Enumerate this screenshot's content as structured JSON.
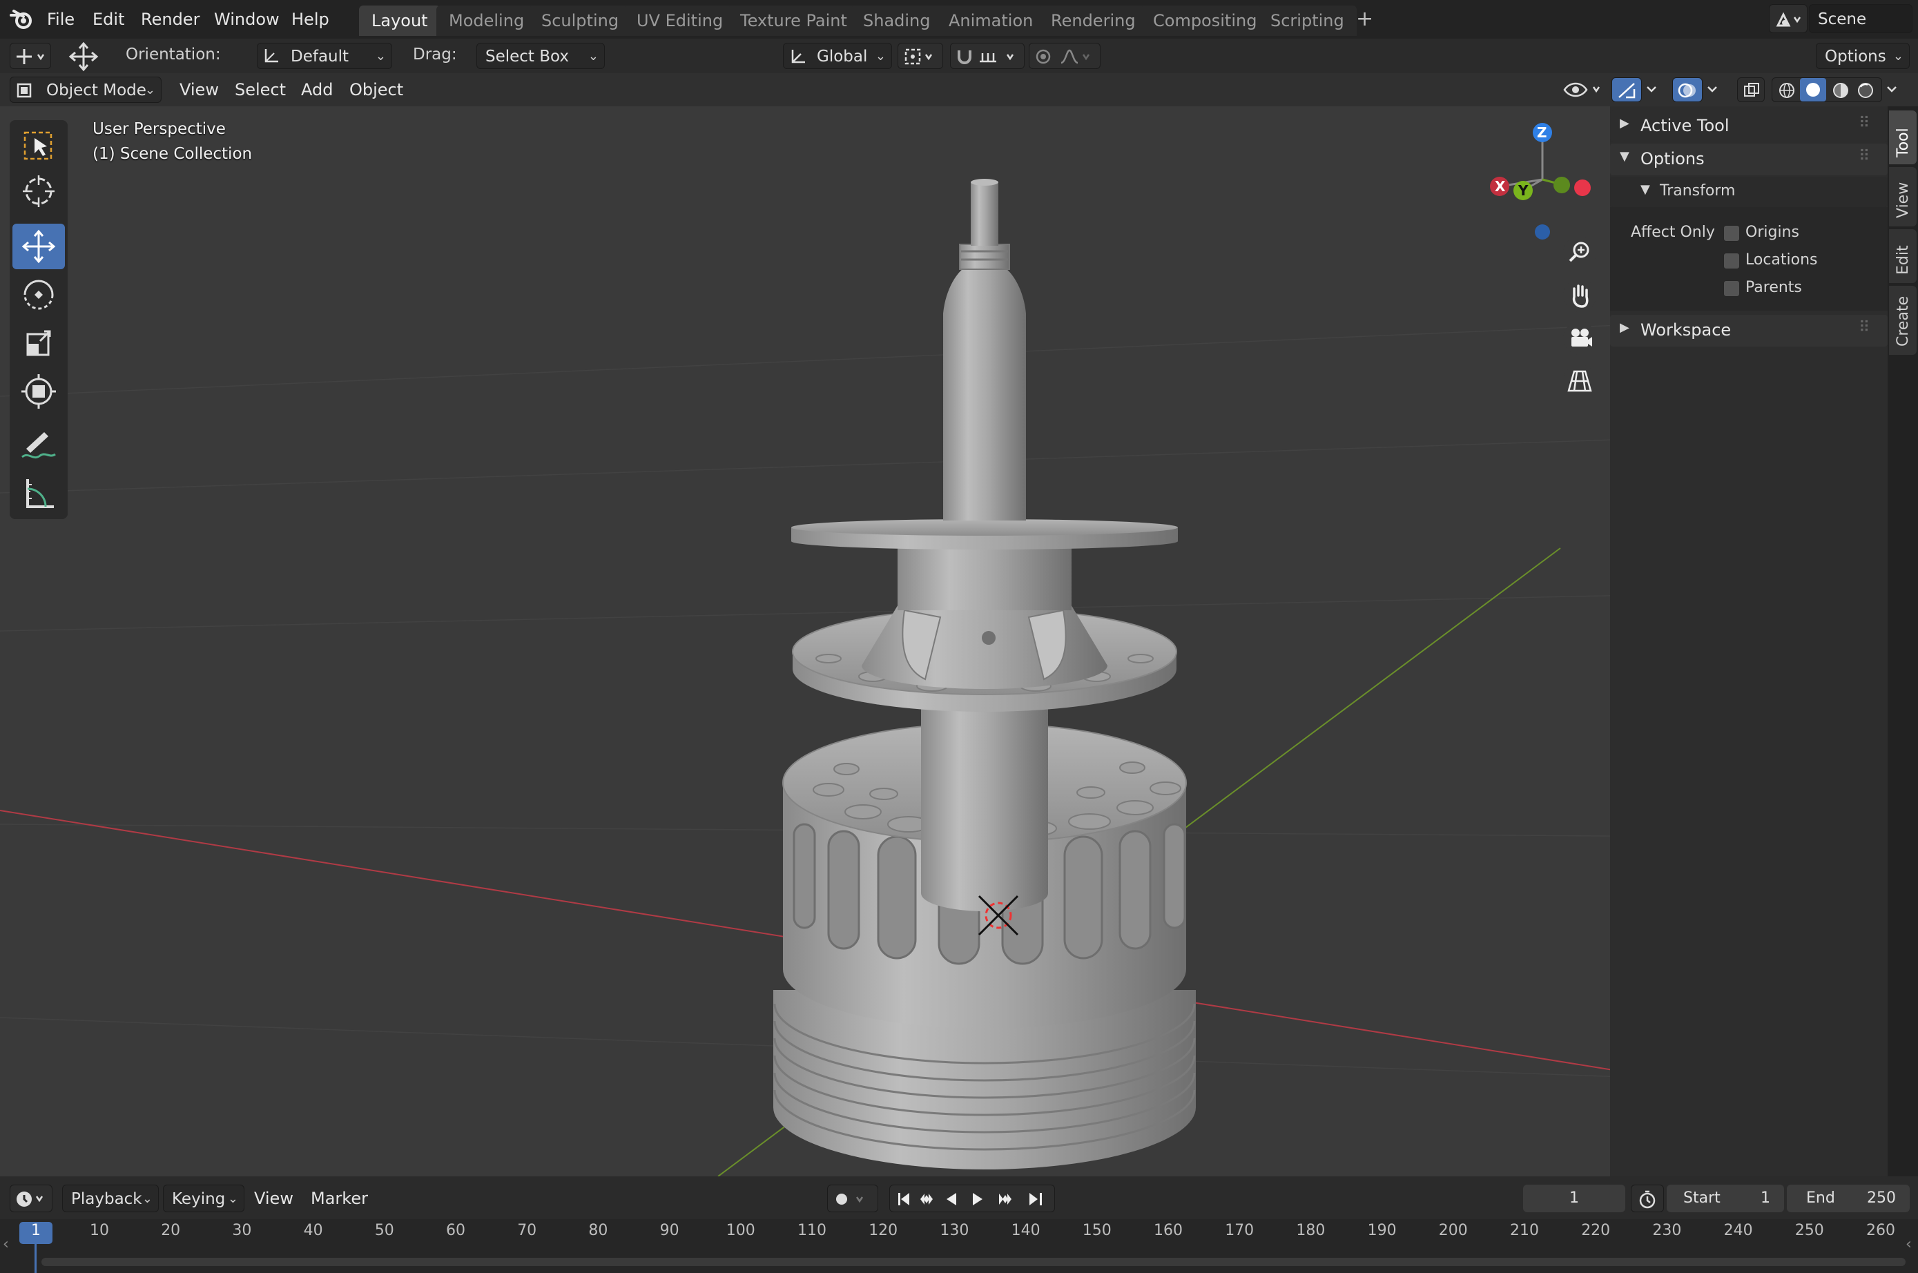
{
  "app": {
    "menu": [
      "File",
      "Edit",
      "Render",
      "Window",
      "Help"
    ],
    "workspaces": [
      "Layout",
      "Modeling",
      "Sculpting",
      "UV Editing",
      "Texture Paint",
      "Shading",
      "Animation",
      "Rendering",
      "Compositing",
      "Scripting"
    ],
    "add_workspace": "+",
    "scene_name": "Scene"
  },
  "tool_header": {
    "orientation_label": "Orientation:",
    "orientation_value": "Default",
    "drag_label": "Drag:",
    "drag_value": "Select Box",
    "transform_space": "Global",
    "options_label": "Options"
  },
  "viewport_header": {
    "mode": "Object Mode",
    "menus": [
      "View",
      "Select",
      "Add",
      "Object"
    ]
  },
  "viewport": {
    "perspective": "User Perspective",
    "collection": "(1) Scene Collection",
    "gizmo_axes": {
      "z": "Z",
      "x": "X",
      "y": "Y"
    },
    "colors": {
      "x_axis": "#c2303f",
      "y_axis": "#6a9a1f",
      "z_axis": "#2f80e6",
      "accent": "#4772b3"
    }
  },
  "tools": [
    "select-box",
    "cursor",
    "move",
    "rotate",
    "scale",
    "transform",
    "annotate",
    "measure"
  ],
  "npanel": {
    "active_tool": "Active Tool",
    "options": "Options",
    "transform": "Transform",
    "affect_only": "Affect Only",
    "checkboxes": [
      {
        "label": "Origins",
        "checked": false
      },
      {
        "label": "Locations",
        "checked": false
      },
      {
        "label": "Parents",
        "checked": false
      }
    ],
    "workspace": "Workspace",
    "tabs": [
      "Tool",
      "View",
      "Edit",
      "Create"
    ]
  },
  "timeline": {
    "menus": [
      "Playback",
      "Keying",
      "View",
      "Marker"
    ],
    "current_frame": "1",
    "start_label": "Start",
    "start_value": "1",
    "end_label": "End",
    "end_value": "250",
    "ticks": [
      "1",
      "10",
      "20",
      "30",
      "40",
      "50",
      "60",
      "70",
      "80",
      "90",
      "100",
      "110",
      "120",
      "130",
      "140",
      "150",
      "160",
      "170",
      "180",
      "190",
      "200",
      "210",
      "220",
      "230",
      "240",
      "250",
      "260"
    ]
  }
}
